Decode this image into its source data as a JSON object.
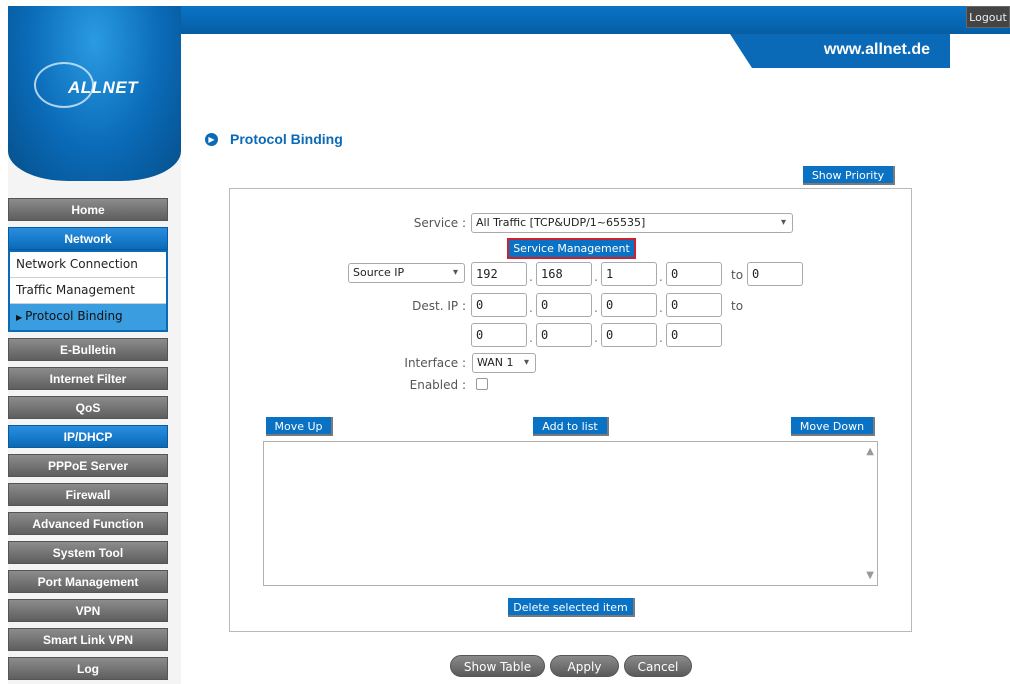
{
  "header": {
    "logout_label": "Logout",
    "website": "www.allnet.de",
    "logo_text": "ALLNET"
  },
  "sidebar": {
    "items": [
      {
        "label": "Home"
      },
      {
        "label": "Network"
      },
      {
        "label": "E-Bulletin"
      },
      {
        "label": "Internet Filter"
      },
      {
        "label": "QoS"
      },
      {
        "label": "IP/DHCP"
      },
      {
        "label": "PPPoE Server"
      },
      {
        "label": "Firewall"
      },
      {
        "label": "Advanced Function"
      },
      {
        "label": "System Tool"
      },
      {
        "label": "Port Management"
      },
      {
        "label": "VPN"
      },
      {
        "label": "Smart Link VPN"
      },
      {
        "label": "Log"
      }
    ],
    "network_sub": [
      {
        "label": "Network Connection"
      },
      {
        "label": "Traffic Management"
      },
      {
        "label": "Protocol Binding"
      }
    ]
  },
  "main": {
    "title": "Protocol Binding",
    "show_priority": "Show Priority",
    "service_label": "Service :",
    "service_value": "All Traffic [TCP&UDP/1~65535]",
    "service_mgmt": "Service Management",
    "source_select": "Source IP",
    "source_ip": [
      "192",
      "168",
      "1",
      "0"
    ],
    "to_label": "to",
    "source_to": "0",
    "dest_label": "Dest. IP :",
    "dest_ip_from": [
      "0",
      "0",
      "0",
      "0"
    ],
    "dest_to_label": "to",
    "dest_ip_to": [
      "0",
      "0",
      "0",
      "0"
    ],
    "interface_label": "Interface :",
    "interface_value": "WAN 1",
    "enabled_label": "Enabled :",
    "move_up": "Move Up",
    "add_to_list": "Add to list",
    "move_down": "Move Down",
    "delete_selected": "Delete selected item"
  },
  "footer": {
    "show_table": "Show Table",
    "apply": "Apply",
    "cancel": "Cancel"
  },
  "colors": {
    "accent": "#0a6ab7",
    "menu_gray": "#6e6e6e",
    "highlight_border": "#d0202a"
  }
}
